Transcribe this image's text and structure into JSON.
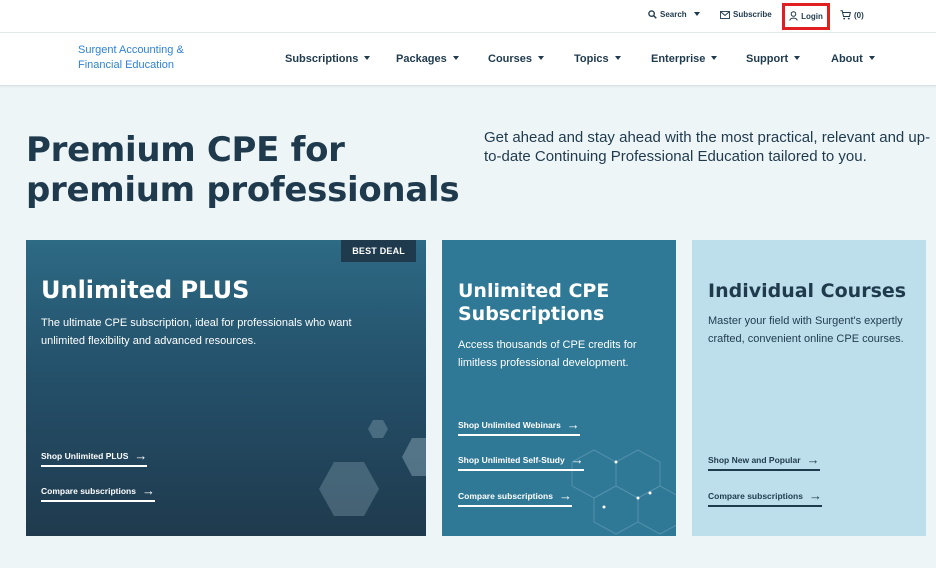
{
  "utility_bar": {
    "search_label": "Search",
    "subscribe_label": "Subscribe",
    "login_label": "Login",
    "cart_label": "(0)"
  },
  "brand": {
    "line1": "Surgent Accounting &",
    "line2": "Financial Education"
  },
  "nav": {
    "items": [
      {
        "label": "Subscriptions"
      },
      {
        "label": "Packages"
      },
      {
        "label": "Courses"
      },
      {
        "label": "Topics"
      },
      {
        "label": "Enterprise"
      },
      {
        "label": "Support"
      },
      {
        "label": "About"
      }
    ]
  },
  "hero": {
    "title_line1": "Premium CPE for",
    "title_line2": "premium professionals",
    "subtitle": "Get ahead and stay ahead with the most practical, relevant and up-to-date Continuing Professional Education tailored to you."
  },
  "cards": [
    {
      "badge": "BEST DEAL",
      "title": "Unlimited PLUS",
      "description": "The ultimate CPE subscription, ideal for professionals who want unlimited flexibility and advanced resources.",
      "links": [
        "Shop Unlimited PLUS",
        "Compare subscriptions"
      ]
    },
    {
      "title": "Unlimited CPE Subscriptions",
      "description": "Access thousands of CPE credits for limitless professional development.",
      "links": [
        "Shop Unlimited Webinars",
        "Shop Unlimited Self-Study",
        "Compare subscriptions"
      ]
    },
    {
      "title": "Individual Courses",
      "description": "Master your field with Surgent's expertly crafted, convenient online CPE courses.",
      "links": [
        "Shop New and Popular",
        "Compare subscriptions"
      ]
    }
  ],
  "colors": {
    "navy": "#1f3a4d",
    "brand_blue": "#2f82d6",
    "card_teal": "#2f7896",
    "card_light": "#bddfeb",
    "highlight_red": "#e02020",
    "page_bg": "#eef5f7"
  },
  "icons": [
    "search-icon",
    "envelope-icon",
    "user-icon",
    "cart-icon",
    "chevron-down-icon",
    "arrow-right-icon"
  ]
}
